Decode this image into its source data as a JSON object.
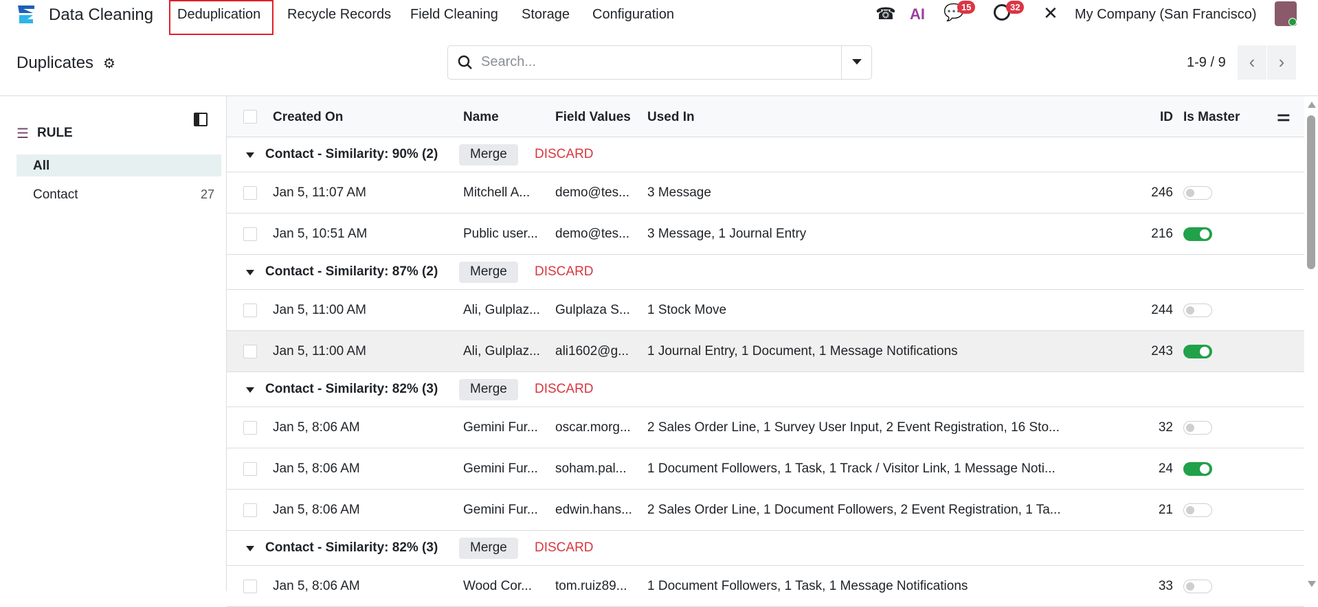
{
  "nav": {
    "app_name": "Data Cleaning",
    "menu": [
      "Deduplication",
      "Recycle Records",
      "Field Cleaning",
      "Storage",
      "Configuration"
    ],
    "ai_label": "AI",
    "messages_count": "15",
    "activities_count": "32",
    "company": "My Company (San Francisco)"
  },
  "control": {
    "title": "Duplicates",
    "search_placeholder": "Search...",
    "pager": "1-9 / 9"
  },
  "sidebar": {
    "header": "RULE",
    "items": [
      {
        "label": "All",
        "count": ""
      },
      {
        "label": "Contact",
        "count": "27"
      }
    ]
  },
  "table": {
    "columns": [
      "Created On",
      "Name",
      "Field Values",
      "Used In",
      "ID",
      "Is Master"
    ],
    "merge_label": "Merge",
    "discard_label": "DISCARD",
    "groups": [
      {
        "label": "Contact - Similarity: 90% (2)",
        "rows": [
          {
            "created": "Jan 5, 11:07 AM",
            "name": "Mitchell A...",
            "field": "demo@tes...",
            "used": "3 Message",
            "id": "246",
            "master": false
          },
          {
            "created": "Jan 5, 10:51 AM",
            "name": "Public user...",
            "field": "demo@tes...",
            "used": "3 Message, 1 Journal Entry",
            "id": "216",
            "master": true
          }
        ]
      },
      {
        "label": "Contact - Similarity: 87% (2)",
        "rows": [
          {
            "created": "Jan 5, 11:00 AM",
            "name": "Ali, Gulplaz...",
            "field": "Gulplaza S...",
            "used": "1 Stock Move",
            "id": "244",
            "master": false
          },
          {
            "created": "Jan 5, 11:00 AM",
            "name": "Ali, Gulplaz...",
            "field": "ali1602@g...",
            "used": "1 Journal Entry, 1 Document, 1 Message Notifications",
            "id": "243",
            "master": true
          }
        ]
      },
      {
        "label": "Contact - Similarity: 82% (3)",
        "rows": [
          {
            "created": "Jan 5, 8:06 AM",
            "name": "Gemini Fur...",
            "field": "oscar.morg...",
            "used": "2 Sales Order Line, 1 Survey User Input, 2 Event Registration, 16 Sto...",
            "id": "32",
            "master": false
          },
          {
            "created": "Jan 5, 8:06 AM",
            "name": "Gemini Fur...",
            "field": "soham.pal...",
            "used": "1 Document Followers, 1 Task, 1 Track / Visitor Link, 1 Message Noti...",
            "id": "24",
            "master": true
          },
          {
            "created": "Jan 5, 8:06 AM",
            "name": "Gemini Fur...",
            "field": "edwin.hans...",
            "used": "2 Sales Order Line, 1 Document Followers, 2 Event Registration, 1 Ta...",
            "id": "21",
            "master": false
          }
        ]
      },
      {
        "label": "Contact - Similarity: 82% (3)",
        "rows": [
          {
            "created": "Jan 5, 8:06 AM",
            "name": "Wood Cor...",
            "field": "tom.ruiz89...",
            "used": "1 Document Followers, 1 Task, 1 Message Notifications",
            "id": "33",
            "master": false
          }
        ]
      }
    ]
  },
  "colors": {
    "accent": "#21a149",
    "discard": "#d9363e",
    "highlight": "#e0202a",
    "badge": "#dc3545"
  }
}
